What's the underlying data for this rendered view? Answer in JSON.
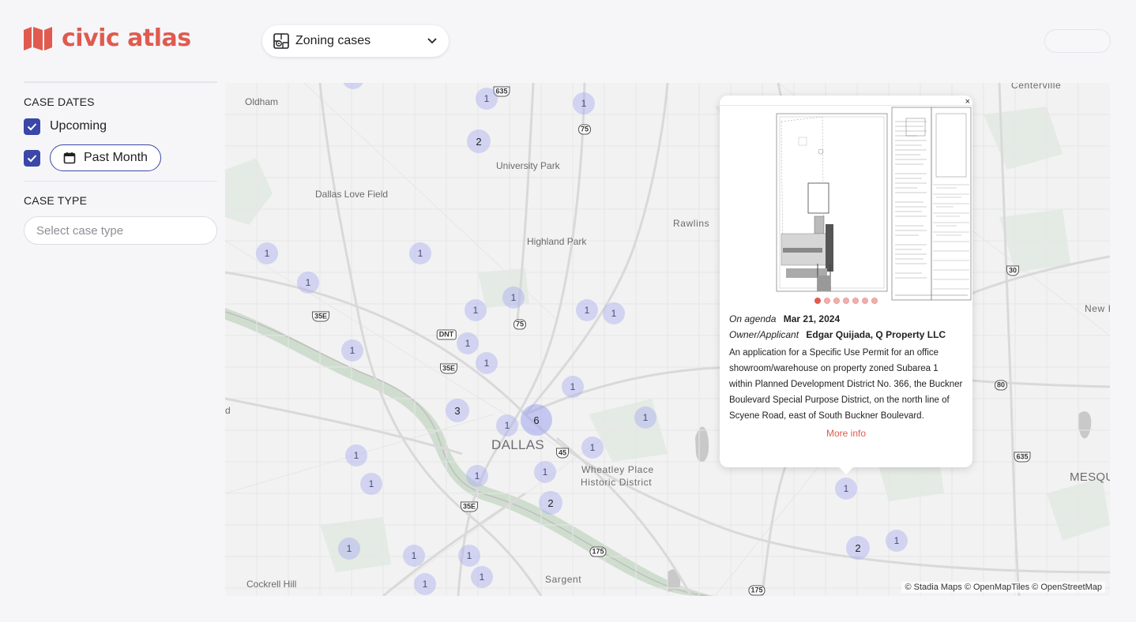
{
  "app": {
    "name": "civic atlas",
    "brand_color": "#e05a4f",
    "accent_color": "#3a46a8"
  },
  "header": {
    "layer_select": {
      "value": "Zoning cases",
      "icon": "map-marker-grid-icon"
    }
  },
  "sidebar": {
    "case_dates_title": "CASE DATES",
    "upcoming_label": "Upcoming",
    "upcoming_checked": true,
    "past_month_label": "Past Month",
    "past_month_checked": true,
    "case_type_title": "CASE TYPE",
    "case_type_placeholder": "Select case type"
  },
  "map": {
    "labels": {
      "oldham": "Oldham",
      "university_park": "University Park",
      "dallas_love_field": "Dallas Love Field",
      "highland_park": "Highland Park",
      "rawlins": "Rawlins",
      "centerville": "Centerville",
      "new_hope": "New H",
      "dallas": "DALLAS",
      "wheatley_1": "Wheatley Place",
      "wheatley_2": "Historic District",
      "mesquite": "MESQU",
      "cockrell_hill": "Cockrell Hill",
      "sargent": "Sargent",
      "edge_d": "d"
    },
    "shields": {
      "s635_top": "635",
      "s75_a": "75",
      "s75_b": "75",
      "s35e_a": "35E",
      "s35e_b": "35E",
      "s35e_c": "35E",
      "dnt": "DNT",
      "s45": "45",
      "s175_a": "175",
      "s175_b": "175",
      "s30": "30",
      "s80": "80",
      "s635_b": "635"
    },
    "clusters": {
      "c01": "1",
      "c02": "1",
      "c03": "2",
      "c04": "1",
      "c05": "1",
      "c06": "1",
      "c07": "1",
      "c08": "1",
      "c09": "1",
      "c10": "1",
      "c11": "1",
      "c12": "1",
      "c13": "1",
      "c14": "1",
      "c15": "1",
      "c16": "3",
      "c17": "6",
      "c18": "1",
      "c19": "1",
      "c20": "1",
      "c21": "1",
      "c22": "1",
      "c23": "1",
      "c24": "1",
      "c25": "2",
      "c26": "1",
      "c27": "1",
      "c28": "1",
      "c29": "1",
      "c30": "1",
      "c31": "1",
      "c32": "2",
      "c33": "1"
    },
    "attribution": "© Stadia Maps © OpenMapTiles © OpenStreetMap"
  },
  "popup": {
    "close": "×",
    "image_count": 7,
    "active_image": 1,
    "agenda_key": "On agenda",
    "agenda_date": "Mar 21, 2024",
    "owner_key": "Owner/Applicant",
    "owner_value": "Edgar Quijada, Q Property LLC",
    "description": "An application for a Specific Use Permit for an office showroom/warehouse on property zoned Subarea 1 within Planned Development District No. 366, the Buckner Boulevard Special Purpose District, on the north line of Scyene Road, east of South Buckner Boulevard.",
    "more_info": "More info"
  }
}
